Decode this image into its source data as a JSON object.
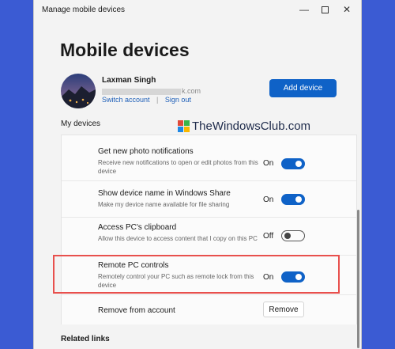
{
  "window": {
    "title": "Manage mobile devices",
    "minimize_glyph": "—",
    "close_glyph": "✕"
  },
  "page": {
    "title": "Mobile devices"
  },
  "account": {
    "name": "Laxman Singh",
    "email_visible": "k.com",
    "switch_label": "Switch account",
    "separator": "|",
    "signout_label": "Sign out",
    "avatar_icon": "user-avatar-photo"
  },
  "add_device_label": "Add device",
  "section_label": "My devices",
  "watermark": {
    "text": "TheWindowsClub.com",
    "logo_colors": [
      "#e04a3a",
      "#3bb54a",
      "#1e88e5",
      "#f9b800"
    ]
  },
  "settings": [
    {
      "title": "Get new photo notifications",
      "description": "Receive new notifications to open or edit photos from this device",
      "state": "On",
      "on": true
    },
    {
      "title": "Show device name in Windows Share",
      "description": "Make my device name available for file sharing",
      "state": "On",
      "on": true
    },
    {
      "title": "Access PC's clipboard",
      "description": "Allow this device to access content that I copy on this PC",
      "state": "Off",
      "on": false
    },
    {
      "title": "Remote PC controls",
      "description": "Remotely control your PC such as remote lock from this device",
      "state": "On",
      "on": true
    }
  ],
  "remove_row": {
    "title": "Remove from account",
    "button_label": "Remove"
  },
  "related_links_label": "Related links",
  "colors": {
    "accent": "#0f62c7",
    "highlight": "#e8504d",
    "background": "#3b5bd3"
  }
}
